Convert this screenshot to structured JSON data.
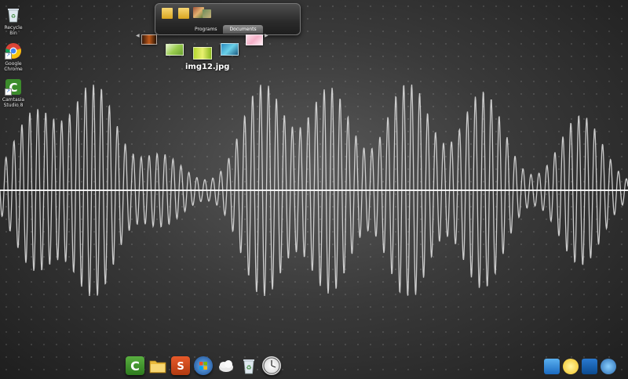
{
  "desktop": {
    "icons": [
      {
        "label": "Recycle Bin",
        "icon": "recycle-bin-icon"
      },
      {
        "label": "Google Chrome",
        "icon": "chrome-icon"
      },
      {
        "label": "Camtasia Studio 8",
        "icon": "camtasia-icon"
      }
    ]
  },
  "stack": {
    "tabs": [
      "Programs",
      "Documents"
    ],
    "active_tab": "Documents",
    "caption": "img12.jpg"
  },
  "dock": {
    "items": [
      "camtasia-icon",
      "folder-icon",
      "presentation-icon",
      "start-orb-icon",
      "weather-icon",
      "recycle-bin-icon",
      "clock-icon"
    ]
  },
  "tray": {
    "items": [
      "network-icon",
      "weather-sun-icon",
      "window-icon",
      "network-globe-icon"
    ]
  },
  "colors": {
    "wave": "#e6e6e6",
    "background": "#3a3a3a"
  }
}
